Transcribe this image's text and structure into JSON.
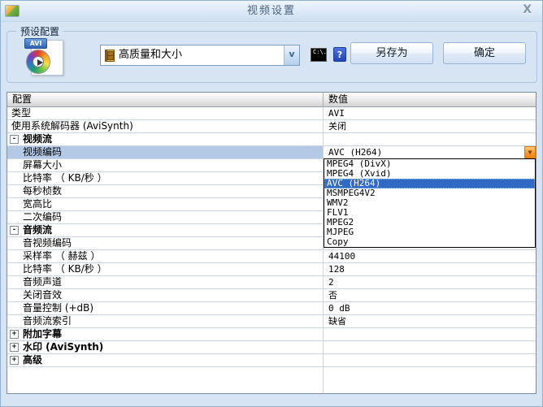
{
  "window": {
    "title": "视频设置",
    "close_glyph": "X"
  },
  "preset": {
    "group_label": "预设配置",
    "combo_value": "高质量和大小",
    "combo_arrow_glyph": "v",
    "cmd_icon_text": "C:\\.",
    "help_label": "?",
    "save_as_label": "另存为",
    "ok_label": "确定"
  },
  "table": {
    "headers": {
      "name": "配置",
      "value": "数值"
    },
    "rows": [
      {
        "type": "plain",
        "label": "类型",
        "value": "AVI"
      },
      {
        "type": "plain",
        "label": "使用系统解码器 (AviSynth)",
        "value": "关闭"
      },
      {
        "type": "group",
        "expanded": true,
        "label": "视频流",
        "value": ""
      },
      {
        "type": "child",
        "selected": true,
        "dropdown": true,
        "label": "视频编码",
        "value": "AVC (H264)"
      },
      {
        "type": "child",
        "label": "屏幕大小",
        "value": ""
      },
      {
        "type": "child",
        "label": "比特率 （ KB/秒 ）",
        "value": ""
      },
      {
        "type": "child",
        "label": "每秒桢数",
        "value": ""
      },
      {
        "type": "child",
        "label": "宽高比",
        "value": ""
      },
      {
        "type": "child",
        "label": "二次编码",
        "value": ""
      },
      {
        "type": "group",
        "expanded": true,
        "label": "音频流",
        "value": ""
      },
      {
        "type": "child",
        "label": "音视频编码",
        "value": ""
      },
      {
        "type": "child",
        "label": "采样率 （ 赫兹 ）",
        "value": "44100"
      },
      {
        "type": "child",
        "label": "比特率 （ KB/秒 ）",
        "value": "128"
      },
      {
        "type": "child",
        "label": "音频声道",
        "value": "2"
      },
      {
        "type": "child",
        "label": "关闭音效",
        "value": "否"
      },
      {
        "type": "child",
        "label": "音量控制 (+dB)",
        "value": "0 dB"
      },
      {
        "type": "child",
        "label": "音频流索引",
        "value": "缺省"
      },
      {
        "type": "group",
        "expanded": false,
        "label": "附加字幕",
        "value": ""
      },
      {
        "type": "group",
        "expanded": false,
        "label": "水印 (AviSynth)",
        "value": ""
      },
      {
        "type": "group",
        "expanded": false,
        "label": "高级",
        "value": ""
      }
    ]
  },
  "codec_dropdown": {
    "items": [
      "MPEG4 (DivX)",
      "MPEG4 (Xvid)",
      "AVC (H264)",
      "MSMPEG4V2",
      "WMV2",
      "FLV1",
      "MPEG2",
      "MJPEG",
      "Copy"
    ],
    "selected_index": 2
  },
  "icons": {
    "avi_badge": "AVI",
    "titlebar_icon": "app-picture-icon",
    "film_icon": "film-strip-icon"
  },
  "colors": {
    "dialog_bg": "#d6e4f3",
    "selection_row": "#b3c9e6",
    "dropdown_selection": "#316ac5",
    "combo_drop_button": "#f79b2e"
  }
}
